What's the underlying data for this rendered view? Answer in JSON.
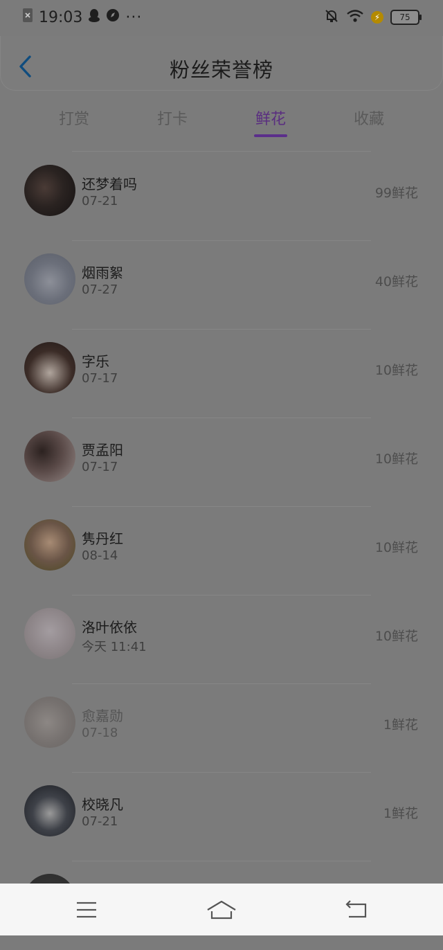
{
  "status_bar": {
    "time": "19:03",
    "battery": "75",
    "icons": [
      "sim-x-icon",
      "qq-penguin-icon",
      "compass-icon",
      "more-dots-icon",
      "mute-bell-icon",
      "wifi-icon",
      "charging-icon",
      "battery-icon"
    ]
  },
  "header": {
    "title": "粉丝荣誉榜",
    "back_icon": "chevron-left-icon"
  },
  "tabs": [
    {
      "label": "打赏",
      "active": false
    },
    {
      "label": "打卡",
      "active": false
    },
    {
      "label": "鲜花",
      "active": true
    },
    {
      "label": "收藏",
      "active": false
    }
  ],
  "colors": {
    "accent": "#5b2e8b",
    "overlay_bg": "#7b7b7b",
    "back_icon": "#0f4c7e"
  },
  "fans": [
    {
      "name": "还梦着吗",
      "date": "07-21",
      "amount": "99鲜花"
    },
    {
      "name": "烟雨絮",
      "date": "07-27",
      "amount": "40鲜花"
    },
    {
      "name": "字乐",
      "date": "07-17",
      "amount": "10鲜花"
    },
    {
      "name": "贾孟阳",
      "date": "07-17",
      "amount": "10鲜花"
    },
    {
      "name": "隽丹红",
      "date": "08-14",
      "amount": "10鲜花"
    },
    {
      "name": "洛叶依依",
      "date": "今天 11:41",
      "amount": "10鲜花"
    },
    {
      "name": "愈嘉勋",
      "date": "07-18",
      "amount": "1鲜花"
    },
    {
      "name": "校晓凡",
      "date": "07-21",
      "amount": "1鲜花"
    },
    {
      "name": "",
      "date": "",
      "amount": ""
    }
  ],
  "nav": [
    "menu-icon",
    "home-icon",
    "back-arrow-icon"
  ]
}
